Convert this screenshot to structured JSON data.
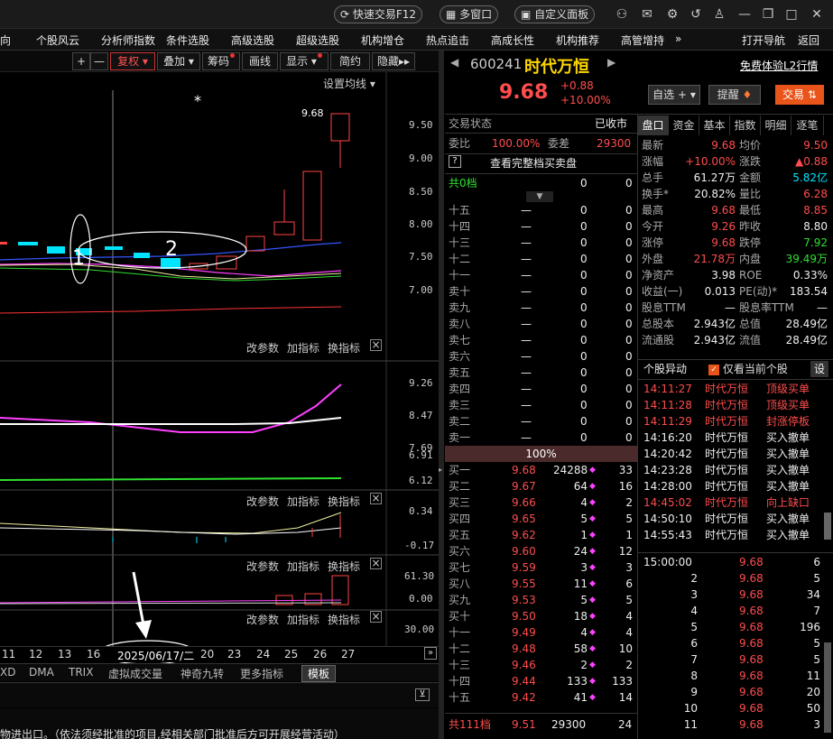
{
  "topbar": {
    "quick_trade": "快速交易F12",
    "multi_window": "多窗口",
    "custom_panel": "自定义面板"
  },
  "nav": {
    "items": [
      "向",
      "个股风云",
      "分析师指数",
      "条件选股",
      "高级选股",
      "超级选股",
      "机构增仓",
      "热点追击",
      "高成长性",
      "机构推荐",
      "高管增持",
      "»"
    ],
    "open_nav": "打开导航",
    "back": "返回"
  },
  "chart_toolbar": {
    "plus": "+",
    "minus": "—",
    "fuquan": "复权",
    "diejia": "叠加",
    "chouma": "筹码",
    "huaxian": "画线",
    "xianshi": "显示",
    "jianyue": "简约",
    "yincang": "隐藏"
  },
  "main_chart": {
    "settings": "设置均线",
    "star": "*",
    "high_price": "9.68",
    "ylabels": [
      "9.50",
      "9.00",
      "8.50",
      "8.00",
      "7.50",
      "7.00"
    ],
    "annot1": "1",
    "annot2": "2"
  },
  "panel_controls": {
    "edit": "改参数",
    "add": "加指标",
    "switch": "换指标",
    "close": "×"
  },
  "panel2": {
    "ylabels": [
      "9.26",
      "8.47",
      "7.69",
      "6.91",
      "6.12"
    ]
  },
  "panel3": {
    "ylabels": [
      "0.34",
      "-0.17"
    ]
  },
  "panel4": {
    "ylabels": [
      "61.30",
      "0.00"
    ]
  },
  "panel5": {
    "ylabels": [
      "30.00"
    ]
  },
  "date_axis": {
    "ticks": [
      "11",
      "12",
      "13",
      "16",
      "20",
      "23",
      "24",
      "25",
      "26",
      "27"
    ],
    "current": "2025/06/17/二"
  },
  "indicator_tabs": [
    "XD",
    "DMA",
    "TRIX",
    "虚拟成交量",
    "神奇九转",
    "更多指标",
    "模板"
  ],
  "footer_text": "物进出口。（依法须经批准的项目,经相关部门批准后方可开展经营活动）",
  "stock": {
    "code": "600241",
    "name": "时代万恒",
    "price": "9.68",
    "change": "+0.88",
    "pct": "+10.00%",
    "l2": "免费体验L2行情",
    "zixuan": "自选",
    "tixing": "提醒",
    "jiaoyi": "交易"
  },
  "orderbook": {
    "state_label": "交易状态",
    "state": "已收市",
    "weibi_label": "委比",
    "weibi": "100.00%",
    "weicha_label": "委差",
    "weicha": "29300",
    "full_depth": "查看完整档买卖盘",
    "sell_total": {
      "label": "共0档",
      "v1": "0",
      "v2": "0"
    },
    "sells": [
      {
        "label": "十五",
        "price": "—",
        "vol": "0",
        "n": "0"
      },
      {
        "label": "十四",
        "price": "—",
        "vol": "0",
        "n": "0"
      },
      {
        "label": "十三",
        "price": "—",
        "vol": "0",
        "n": "0"
      },
      {
        "label": "十二",
        "price": "—",
        "vol": "0",
        "n": "0"
      },
      {
        "label": "十一",
        "price": "—",
        "vol": "0",
        "n": "0"
      },
      {
        "label": "卖十",
        "price": "—",
        "vol": "0",
        "n": "0"
      },
      {
        "label": "卖九",
        "price": "—",
        "vol": "0",
        "n": "0"
      },
      {
        "label": "卖八",
        "price": "—",
        "vol": "0",
        "n": "0"
      },
      {
        "label": "卖七",
        "price": "—",
        "vol": "0",
        "n": "0"
      },
      {
        "label": "卖六",
        "price": "—",
        "vol": "0",
        "n": "0"
      },
      {
        "label": "卖五",
        "price": "—",
        "vol": "0",
        "n": "0"
      },
      {
        "label": "卖四",
        "price": "—",
        "vol": "0",
        "n": "0"
      },
      {
        "label": "卖三",
        "price": "—",
        "vol": "0",
        "n": "0"
      },
      {
        "label": "卖二",
        "price": "—",
        "vol": "0",
        "n": "0"
      },
      {
        "label": "卖一",
        "price": "—",
        "vol": "0",
        "n": "0"
      }
    ],
    "ratio": "100%",
    "buys": [
      {
        "label": "买一",
        "price": "9.68",
        "vol": "24288",
        "n": "33",
        "mark": "◆"
      },
      {
        "label": "买二",
        "price": "9.67",
        "vol": "64",
        "n": "16",
        "mark": "◆"
      },
      {
        "label": "买三",
        "price": "9.66",
        "vol": "4",
        "n": "2",
        "mark": "◆"
      },
      {
        "label": "买四",
        "price": "9.65",
        "vol": "5",
        "n": "5",
        "mark": "◆"
      },
      {
        "label": "买五",
        "price": "9.62",
        "vol": "1",
        "n": "1",
        "mark": "◆"
      },
      {
        "label": "买六",
        "price": "9.60",
        "vol": "24",
        "n": "12",
        "mark": "◆"
      },
      {
        "label": "买七",
        "price": "9.59",
        "vol": "3",
        "n": "3",
        "mark": "◆"
      },
      {
        "label": "买八",
        "price": "9.55",
        "vol": "11",
        "n": "6",
        "mark": "◆"
      },
      {
        "label": "买九",
        "price": "9.53",
        "vol": "5",
        "n": "5",
        "mark": "◆"
      },
      {
        "label": "买十",
        "price": "9.50",
        "vol": "18",
        "n": "4",
        "mark": "◆"
      },
      {
        "label": "十一",
        "price": "9.49",
        "vol": "4",
        "n": "4",
        "mark": "◆"
      },
      {
        "label": "十二",
        "price": "9.48",
        "vol": "58",
        "n": "10",
        "mark": "◆"
      },
      {
        "label": "十三",
        "price": "9.46",
        "vol": "2",
        "n": "2",
        "mark": "◆"
      },
      {
        "label": "十四",
        "price": "9.44",
        "vol": "133",
        "n": "133",
        "mark": "◆"
      },
      {
        "label": "十五",
        "price": "9.42",
        "vol": "41",
        "n": "14",
        "mark": "◆"
      }
    ],
    "buy_total": {
      "label": "共111档",
      "price": "9.51",
      "vol": "29300",
      "n": "24"
    }
  },
  "quote_tabs": [
    "盘口",
    "资金",
    "基本",
    "指数",
    "明细",
    "逐笔"
  ],
  "quote": [
    [
      {
        "l": "最新",
        "v": "9.68",
        "c": "red"
      },
      {
        "l": "均价",
        "v": "9.50",
        "c": "red"
      }
    ],
    [
      {
        "l": "涨幅",
        "v": "+10.00%",
        "c": "red"
      },
      {
        "l": "涨跌",
        "v": "▲0.88",
        "c": "red"
      }
    ],
    [
      {
        "l": "总手",
        "v": "61.27万",
        "c": "white"
      },
      {
        "l": "金额",
        "v": "5.82亿",
        "c": "cyan"
      }
    ],
    [
      {
        "l": "换手*",
        "v": "20.82%",
        "c": "white"
      },
      {
        "l": "量比",
        "v": "6.28",
        "c": "red"
      }
    ],
    [
      {
        "l": "最高",
        "v": "9.68",
        "c": "red"
      },
      {
        "l": "最低",
        "v": "8.85",
        "c": "red"
      }
    ],
    [
      {
        "l": "今开",
        "v": "9.26",
        "c": "red"
      },
      {
        "l": "昨收",
        "v": "8.80",
        "c": "white"
      }
    ],
    [
      {
        "l": "涨停",
        "v": "9.68",
        "c": "red"
      },
      {
        "l": "跌停",
        "v": "7.92",
        "c": "green"
      }
    ],
    [
      {
        "l": "外盘",
        "v": "21.78万",
        "c": "red"
      },
      {
        "l": "内盘",
        "v": "39.49万",
        "c": "green"
      }
    ],
    [
      {
        "l": "净资产",
        "v": "3.98",
        "c": "white"
      },
      {
        "l": "ROE",
        "v": "0.33%",
        "c": "white"
      }
    ],
    [
      {
        "l": "收益(一)",
        "v": "0.013",
        "c": "white"
      },
      {
        "l": "PE(动)*",
        "v": "183.54",
        "c": "white"
      }
    ],
    [
      {
        "l": "股息TTM",
        "v": "—",
        "c": "white"
      },
      {
        "l": "股息率TTM",
        "v": "—",
        "c": "white"
      }
    ],
    [
      {
        "l": "总股本",
        "v": "2.943亿",
        "c": "white"
      },
      {
        "l": "总值",
        "v": "28.49亿",
        "c": "white"
      }
    ],
    [
      {
        "l": "流通股",
        "v": "2.943亿",
        "c": "white"
      },
      {
        "l": "流值",
        "v": "28.49亿",
        "c": "white"
      }
    ]
  ],
  "events": {
    "title": "个股异动",
    "filter": "仅看当前个股",
    "settings": "设",
    "rows": [
      {
        "t": "14:11:27",
        "n": "时代万恒",
        "e": "顶级买单",
        "c": "red"
      },
      {
        "t": "14:11:28",
        "n": "时代万恒",
        "e": "顶级买单",
        "c": "red"
      },
      {
        "t": "14:11:29",
        "n": "时代万恒",
        "e": "封涨停板",
        "c": "red"
      },
      {
        "t": "14:16:20",
        "n": "时代万恒",
        "e": "买入撤单",
        "c": "white"
      },
      {
        "t": "14:20:42",
        "n": "时代万恒",
        "e": "买入撤单",
        "c": "white"
      },
      {
        "t": "14:23:28",
        "n": "时代万恒",
        "e": "买入撤单",
        "c": "white"
      },
      {
        "t": "14:28:00",
        "n": "时代万恒",
        "e": "买入撤单",
        "c": "white"
      },
      {
        "t": "14:45:02",
        "n": "时代万恒",
        "e": "向上缺口",
        "c": "red"
      },
      {
        "t": "14:50:10",
        "n": "时代万恒",
        "e": "买入撤单",
        "c": "white"
      },
      {
        "t": "14:55:43",
        "n": "时代万恒",
        "e": "买入撤单",
        "c": "white"
      }
    ]
  },
  "ticks": [
    {
      "t": "15:00:00",
      "p": "9.68",
      "v": "6"
    },
    {
      "t": "2",
      "p": "9.68",
      "v": "5"
    },
    {
      "t": "3",
      "p": "9.68",
      "v": "34"
    },
    {
      "t": "4",
      "p": "9.68",
      "v": "7"
    },
    {
      "t": "5",
      "p": "9.68",
      "v": "196"
    },
    {
      "t": "6",
      "p": "9.68",
      "v": "5"
    },
    {
      "t": "7",
      "p": "9.68",
      "v": "5"
    },
    {
      "t": "8",
      "p": "9.68",
      "v": "11"
    },
    {
      "t": "9",
      "p": "9.68",
      "v": "20"
    },
    {
      "t": "10",
      "p": "9.68",
      "v": "50"
    },
    {
      "t": "11",
      "p": "9.68",
      "v": "3"
    }
  ]
}
